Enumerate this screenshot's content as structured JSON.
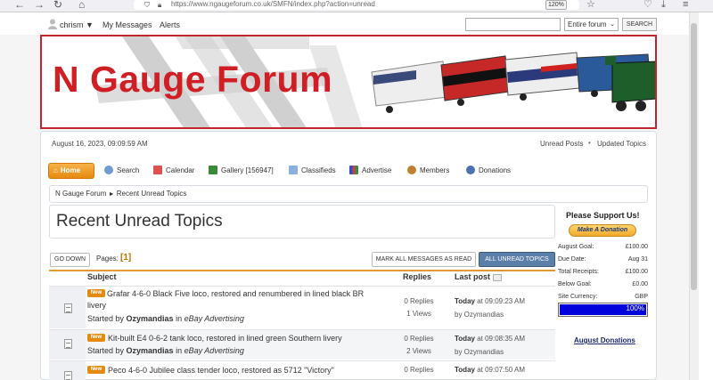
{
  "browser": {
    "url": "https://www.ngaugeforum.co.uk/SMFN/index.php?action=unread",
    "zoom": "120%"
  },
  "userbar": {
    "username": "chrism",
    "my_messages": "My Messages",
    "alerts": "Alerts",
    "search_scope": "Entire forum",
    "search_button": "SEARCH"
  },
  "banner": {
    "title": "N Gauge Forum"
  },
  "header": {
    "date": "August 16, 2023, 09:09:59 AM",
    "unread_posts": "Unread Posts",
    "separator": "•",
    "updated_topics": "Updated Topics"
  },
  "menu": {
    "items": [
      {
        "label": "Home",
        "icon": "home-icon"
      },
      {
        "label": "Search",
        "icon": "search-icon",
        "color": "#4a7fc0"
      },
      {
        "label": "Calendar",
        "icon": "calendar-icon",
        "color": "#d04040"
      },
      {
        "label": "Gallery [156947]",
        "icon": "gallery-icon",
        "color": "#3a8a3a"
      },
      {
        "label": "Classifieds",
        "icon": "classifieds-icon",
        "color": "#6a9ad0"
      },
      {
        "label": "Advertise",
        "icon": "chart-icon",
        "color": "#4a5ac0"
      },
      {
        "label": "Members",
        "icon": "members-icon",
        "color": "#c08030"
      },
      {
        "label": "Donations",
        "icon": "donations-icon",
        "color": "#4a70b0"
      }
    ]
  },
  "breadcrumb": {
    "root": "N Gauge Forum",
    "arrow": "►",
    "current": "Recent Unread Topics"
  },
  "page_title": "Recent Unread Topics",
  "actions": {
    "go_down": "GO DOWN",
    "pages_label": "Pages:",
    "pages_value": "[1]",
    "mark_all": "MARK ALL MESSAGES AS READ",
    "all_unread": "ALL UNREAD TOPICS"
  },
  "table": {
    "headers": {
      "subject": "Subject",
      "replies": "Replies",
      "last_post": "Last post"
    },
    "rows": [
      {
        "badge": "New",
        "title_line1": "Grafar 4-6-0 Black Five loco, restored and renumbered in lined black BR",
        "title_line2": "livery",
        "started_by": "Started by",
        "starter": "Ozymandias",
        "in": "in",
        "board": "eBay Advertising",
        "replies": "0 Replies",
        "views": "1 Views",
        "last_day": "Today",
        "last_time": "at 09:09:23 AM",
        "last_by": "by Ozymandias"
      },
      {
        "badge": "New",
        "title_line1": "Kit-built E4 0-6-2 tank loco, restored in lined green Southern livery",
        "title_line2": "",
        "started_by": "Started by",
        "starter": "Ozymandias",
        "in": "in",
        "board": "eBay Advertising",
        "replies": "0 Replies",
        "views": "2 Views",
        "last_day": "Today",
        "last_time": "at 09:08:35 AM",
        "last_by": "by Ozymandias"
      },
      {
        "badge": "New",
        "title_line1": "Peco 4-6-0 Jubilee class tender loco, restored as 5712 \"Victory\"",
        "title_line2": "",
        "replies": "0 Replies",
        "last_day": "Today",
        "last_time": "at 09:07:50 AM"
      }
    ]
  },
  "sidebar": {
    "support_title": "Please Support Us!",
    "donate_button": "Make A Donation",
    "rows": [
      {
        "label": "August Goal:",
        "value": "£100.00"
      },
      {
        "label": "Due Date:",
        "value": "Aug 31"
      },
      {
        "label": "Total Receipts:",
        "value": "£100.00"
      },
      {
        "label": "Below Goal:",
        "value": "£0.00"
      },
      {
        "label": "Site Currency:",
        "value": "GBP"
      }
    ],
    "progress_percent": 100,
    "progress_text": "100%",
    "donations_link": "August Donations"
  }
}
